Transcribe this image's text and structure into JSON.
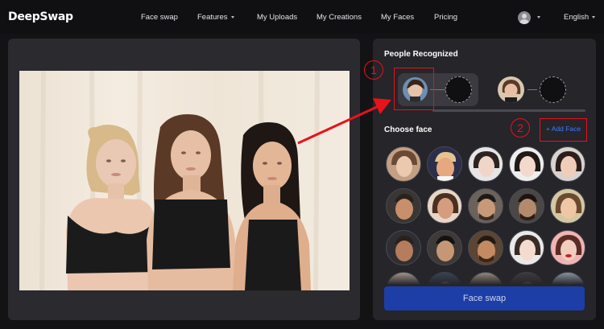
{
  "header": {
    "logo": "DeepSwap",
    "nav": [
      {
        "label": "Face swap",
        "has_caret": false
      },
      {
        "label": "Features",
        "has_caret": true
      },
      {
        "label": "My Uploads",
        "has_caret": false
      },
      {
        "label": "My Creations",
        "has_caret": false
      },
      {
        "label": "My Faces",
        "has_caret": false
      },
      {
        "label": "Pricing",
        "has_caret": false
      }
    ],
    "avatar_icon": "user-avatar-icon",
    "language": "English"
  },
  "main_photo": {
    "people_count": 3
  },
  "panel": {
    "people_title": "People Recognized",
    "choose_title": "Choose face",
    "add_face": "Add Face",
    "add_icon": "plus-icon",
    "swap_button": "Face swap",
    "recognized_count": 2,
    "face_options_rows_visible": 4,
    "face_options_per_row": 5
  },
  "annotations": {
    "step1": "1",
    "step2": "2",
    "color": "#e8121a"
  },
  "colors": {
    "accent_blue": "#3d7dff",
    "button_blue": "#1d3ea6",
    "panel_bg": "#25252a"
  }
}
